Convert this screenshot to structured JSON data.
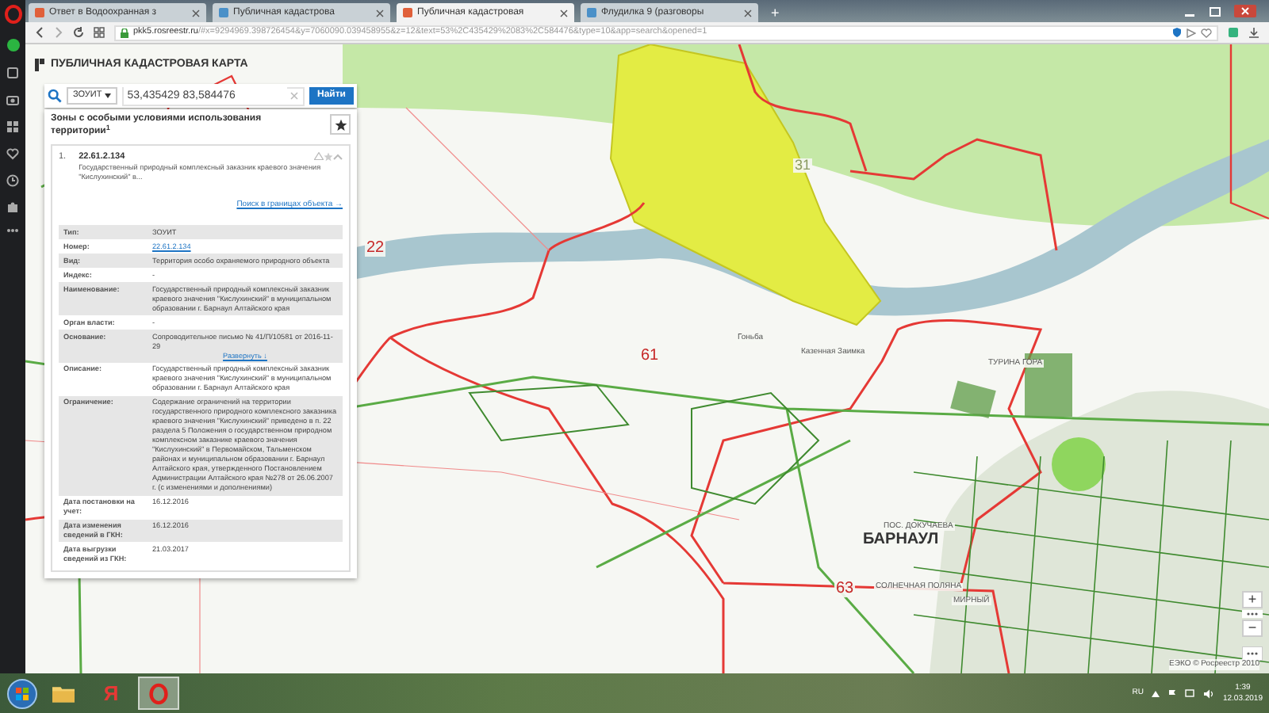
{
  "browser": {
    "tabs": [
      {
        "title": "Ответ в Водоохранная з",
        "selected": false
      },
      {
        "title": "Публичная кадастрова",
        "selected": false
      },
      {
        "title": "Публичная кадастровая",
        "selected": true
      },
      {
        "title": "Флудилка 9 (разговоры",
        "selected": false
      }
    ],
    "new_tab": "+",
    "address": "pkk5.rosreestr.ru/#x=9294969.398726454&y=7060090.039458955&z=12&text=53%2C435429%2083%2C584476&type=10&app=search&opened=1"
  },
  "map": {
    "header": "ПУБЛИЧНАЯ КАДАСТРОВАЯ КАРТА",
    "search": {
      "type": "ЗОУИТ",
      "value": "53,435429 83,584476",
      "button": "Найти"
    },
    "panel": {
      "title": "Зоны с особыми условиями использования территории$^{1}$",
      "result": {
        "index": "1.",
        "number": "22.61.2.134",
        "description": "Государственный природный комплексный заказник краевого значения \"Кислухинский\" в...",
        "link": "Поиск в границах объекта →"
      },
      "attributes": [
        {
          "label": "Тип:",
          "value": "ЗОУИТ",
          "kind": "text"
        },
        {
          "label": "Номер:",
          "value": "22.61.2.134",
          "kind": "link"
        },
        {
          "label": "Вид:",
          "value": "Территория особо охраняемого природного объекта",
          "kind": "text"
        },
        {
          "label": "Индекс:",
          "value": "-",
          "kind": "text"
        },
        {
          "label": "Наименование:",
          "value": "Государственный природный комплексный заказник краевого значения \"Кислухинский\" в муниципальном образовании г. Барнаул Алтайского края",
          "kind": "text"
        },
        {
          "label": "Орган власти:",
          "value": "-",
          "kind": "text"
        },
        {
          "label": "Основание:",
          "value": "Сопроводительное письмо № 41/П/10581 от 2016-11-29",
          "kind": "expand",
          "expand": "Развернуть ↓"
        },
        {
          "label": "Описание:",
          "value": "Государственный природный комплексный заказник краевого значения \"Кислухинский\" в муниципальном образовании г. Барнаул Алтайского края",
          "kind": "text"
        },
        {
          "label": "Ограничение:",
          "value": "Содержание ограничений на территории государственного природного комплексного заказника краевого значения \"Кислухинский\" приведено в п. 22 раздела 5 Положения о государственном природном комплексном заказнике краевого значения \"Кислухинский\" в Первомайском, Тальменском районах и муниципальном образовании г. Барнаул Алтайского края, утвержденного Постановлением Администрации Алтайского края №278 от 26.06.2007 г. (с изменениями и дополнениями)",
          "kind": "text"
        },
        {
          "label": "Дата постановки на учет:",
          "value": "16.12.2016",
          "kind": "text"
        },
        {
          "label": "Дата изменения сведений в ГКН:",
          "value": "16.12.2016",
          "kind": "text"
        },
        {
          "label": "Дата выгрузки сведений из ГКН:",
          "value": "21.03.2017",
          "kind": "text"
        }
      ]
    },
    "labels": [
      {
        "text": "22",
        "kind": "zone"
      },
      {
        "text": "31",
        "kind": "zone_faint"
      },
      {
        "text": "61",
        "kind": "zone"
      },
      {
        "text": "63",
        "kind": "zone"
      },
      {
        "text": "Гоньба",
        "kind": "place"
      },
      {
        "text": "Казенная Заимка",
        "kind": "place"
      },
      {
        "text": "ТУРИНА ГОРА",
        "kind": "place"
      },
      {
        "text": "ПОС. ДОКУЧАЕВА",
        "kind": "place"
      },
      {
        "text": "БАРНАУЛ",
        "kind": "city"
      },
      {
        "text": "СОЛНЕЧНАЯ ПОЛЯНА",
        "kind": "place"
      },
      {
        "text": "МИРНЫЙ",
        "kind": "place"
      }
    ],
    "zoom_controls": [
      "+",
      "−"
    ],
    "copyright": "ЕЭКО © Росреестр 2010"
  },
  "taskbar": {
    "apps": [
      {
        "kind": "folder"
      },
      {
        "kind": "letter",
        "glyph": "Я"
      },
      {
        "kind": "opera",
        "selected": true
      }
    ],
    "language": "RU",
    "time": "1:39",
    "date": "12.03.2019"
  }
}
